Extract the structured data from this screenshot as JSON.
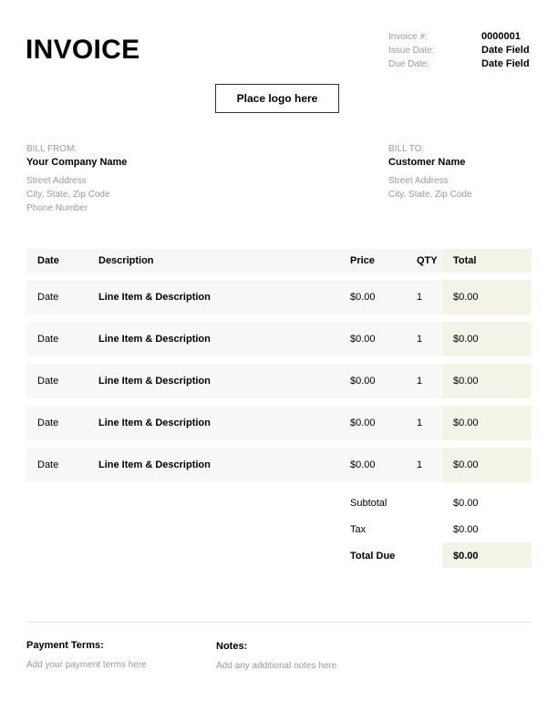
{
  "invoice": {
    "title": "INVOICE",
    "meta": [
      {
        "label": "Invoice #:",
        "value": "0000001"
      },
      {
        "label": "Issue Date:",
        "value": "Date Field"
      },
      {
        "label": "Due Date:",
        "value": "Date Field"
      }
    ],
    "logo_placeholder": "Place logo here"
  },
  "bill_from": {
    "caption": "BILL FROM:",
    "name": "Your Company Name",
    "lines": [
      "Street Address",
      "City, State, Zip Code",
      "Phone Number"
    ]
  },
  "bill_to": {
    "caption": "BILL TO:",
    "name": "Customer Name",
    "lines": [
      "Street Address",
      "City, State, Zip Code"
    ]
  },
  "table": {
    "headers": {
      "date": "Date",
      "description": "Description",
      "price": "Price",
      "qty": "QTY",
      "total": "Total"
    },
    "rows": [
      {
        "date": "Date",
        "description": "Line Item & Description",
        "price": "$0.00",
        "qty": "1",
        "total": "$0.00"
      },
      {
        "date": "Date",
        "description": "Line Item & Description",
        "price": "$0.00",
        "qty": "1",
        "total": "$0.00"
      },
      {
        "date": "Date",
        "description": "Line Item & Description",
        "price": "$0.00",
        "qty": "1",
        "total": "$0.00"
      },
      {
        "date": "Date",
        "description": "Line Item & Description",
        "price": "$0.00",
        "qty": "1",
        "total": "$0.00"
      },
      {
        "date": "Date",
        "description": "Line Item & Description",
        "price": "$0.00",
        "qty": "1",
        "total": "$0.00"
      }
    ]
  },
  "summary": {
    "subtotal_label": "Subtotal",
    "subtotal_value": "$0.00",
    "tax_label": "Tax",
    "tax_value": "$0.00",
    "total_due_label": "Total Due",
    "total_due_value": "$0.00"
  },
  "footer": {
    "payment_terms_title": "Payment Terms:",
    "payment_terms_text": "Add your payment terms here",
    "notes_title": "Notes:",
    "notes_text": "Add any additional notes here"
  },
  "colors": {
    "total_column_bg": "#f3f3e8",
    "row_bg": "#f8f8f8",
    "muted_text": "#999999"
  }
}
